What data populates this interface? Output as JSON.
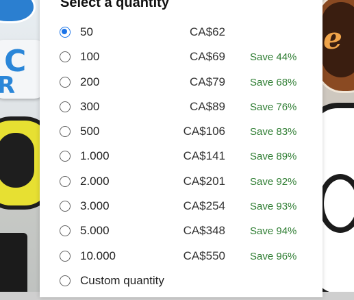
{
  "title": "Select a quantity",
  "selected_index": 0,
  "options": [
    {
      "quantity": "50",
      "price": "CA$62",
      "save": ""
    },
    {
      "quantity": "100",
      "price": "CA$69",
      "save": "Save 44%"
    },
    {
      "quantity": "200",
      "price": "CA$79",
      "save": "Save 68%"
    },
    {
      "quantity": "300",
      "price": "CA$89",
      "save": "Save 76%"
    },
    {
      "quantity": "500",
      "price": "CA$106",
      "save": "Save 83%"
    },
    {
      "quantity": "1.000",
      "price": "CA$141",
      "save": "Save 89%"
    },
    {
      "quantity": "2.000",
      "price": "CA$201",
      "save": "Save 92%"
    },
    {
      "quantity": "3.000",
      "price": "CA$254",
      "save": "Save 93%"
    },
    {
      "quantity": "5.000",
      "price": "CA$348",
      "save": "Save 94%"
    },
    {
      "quantity": "10.000",
      "price": "CA$550",
      "save": "Save 96%"
    }
  ],
  "custom_option": {
    "label": "Custom quantity"
  },
  "colors": {
    "accent": "#1a73e8",
    "save_text": "#2e7d32",
    "panel_background": "#ffffff"
  }
}
